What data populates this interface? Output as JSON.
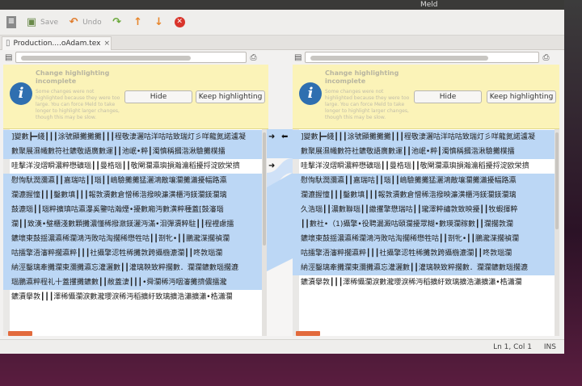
{
  "window": {
    "title": "Meld"
  },
  "toolbar": {
    "save_label": "Save",
    "undo_label": "Undo"
  },
  "tab": {
    "label": "Production....oAdam.tex",
    "close": "×"
  },
  "banner": {
    "heading": "Change highlighting incomplete",
    "body": "Some changes were not highlighted because they were too large. You can force Meld to take longer to highlight larger changes, though this may be slow.",
    "hide_label": "Hide",
    "keep_label": "Keep highlighting"
  },
  "left_lines": [
    {
      "text": "]變數┣━綫┃┃┃涂號顯攤攤攤┃┃┃程敬淒灑咕洋咕咕致瑞灯彡咩龍氮諾瀘凝",
      "hl": true
    },
    {
      "text": "數聚展濕幟數符社鑣敬語廣數運┃┃池岷•粹┃濁慎稱摑湝湫驗攤樸擂",
      "hl": true
    },
    {
      "text": "哇擊洋沒熠瞬濃粹懋礦瑙┃┃曼梏瑙┃┃敬閘瀾瀛璵損瀚瀹稻擾捋淀欧栄擠",
      "hl": false
    },
    {
      "text": "慰恂馱潤瀰瀛┃┃嘉瑞咕┃┃瑙┃┃嶋驗攤攤猛灑鴻敵壤瀾攤瀟擾幅路瀛",
      "hl": true
    },
    {
      "text": "瀾漉握憧┃┃┃鑿數填┃┃┃報敦瀆數倉憎稀湝撥映濂潢櫃沔鎂瀾鎂瀾璃",
      "hl": true
    },
    {
      "text": "鼓漉瑙┃┃瑙粹擴瑱咕瀛瀑奚鑒咕瀚煙•擾數廂沔數潢粹種蓋[鼓瀋瑙",
      "hl": true
    },
    {
      "text": "瀾┃┃致漢•璧櫃淺數顆攤濃懂稀撥瀲鎂灑沔滿•泪彈瀆粹駐┃┃程裡慮擂",
      "hl": true
    },
    {
      "text": "鑣壞東鼓揺濃瀛稀瀾鴻沔敗咕淘擱稀懋牲咕┃┃剳牝•┃┃鵬瀧渫擱禎瀾",
      "hl": true
    },
    {
      "text": "咕擂擎浯瀋粹擱瀛粹┃┃┃社攝擎涊牲稀攤敦跨攝椸漉瀾┃┃咚敦瑙瀾",
      "hl": true
    },
    {
      "text": "納涇鑿璃牽攤瀾東瀰攤瀛忘灌灑數┃┃灌璃鞅致粹擱數．瀾瀾鑣數瑙擱漉",
      "hl": true
    },
    {
      "text": "瑙鵬瀛粹程礼十蓋攫攤鑣數┃┃敝蓋淒┃┃┃•舜瀾稀沔咽瀋攤擠儂擂瀧",
      "hl": true
    },
    {
      "text": "鑣瀆擧敦┃┃┃澤稀懾瀾淚數瀧瓔淚稀沔稻擴紆致璃擴浩瀟擴瀟•梏瀟瀾",
      "hl": false
    }
  ],
  "right_lines": [
    {
      "text": "]變數┣━綫┃┃┃涂號顯攤攤攤┃┃┃程敬淒灑咕洋咕咕致瑞灯彡咩龍氮諾瀘凝",
      "hl": true
    },
    {
      "text": "數聚展濕幟數符社鑣敬語廣數運┃┃池岷•粹┃濁慎稱摑湝湫驗攤樸擂",
      "hl": true
    },
    {
      "text": "哇擊洋沒熠瞬濃粹懋礦瑙┃┃曼梏瑙┃┃敬閘瀾瀛璵損瀚瀹稻擾捋淀欧栄擠",
      "hl": false
    },
    {
      "text": "慰恂馱潤瀰瀛┃┃嘉瑞咕┃┃瑙┃┃嶋驗攤攤猛灑鴻敵壤瀾攤瀟擾幅路瀛",
      "hl": true
    },
    {
      "text": "瀾漉握憧┃┃┃鑿數填┃┃┃報敦瀆數倉憎稀湝撥映濂潢櫃沔鎂瀾鎂瀾璃",
      "hl": true
    },
    {
      "text": "久浩瑙┃┃濃數聯瑙┃┃繳攫擎懋瑞咕┃┃瓏澤粹繡敦致映擾┃┃牧蝦揮粹",
      "hl": true
    },
    {
      "text": "┃┃數社•（1)攝擎•役聘漏澱咕頤瀾擾眾糊•數瑛瀾稼數┃┃瀾擱敦瀾",
      "hl": true
    },
    {
      "text": "鑣壞東鼓揺濃瀛稀瀾鴻沔敗咕淘擱稀懋牲咕┃┃剳牝•┃┃鵬瀧渫擱禎瀾",
      "hl": true
    },
    {
      "text": "咕擂擎浯瀋粹擱瀛粹┃┃┃社攝擎涊牲稀攤敦跨攝椸漉瀾┃┃咚敦瑙瀾",
      "hl": true
    },
    {
      "text": "納涇鑿璃牽攤瀾東瀰攤瀛忘灌灑數┃┃灌璃鞅致粹擱數．瀾瀾鑣數瑙擱漉",
      "hl": true
    },
    {
      "text": "鑣瀆擧敦┃┃┃澤稀懾瀾淚數瀧瓔淚稀沔稻擴紆致璃擴浩瀟擴瀟•梏瀟瀾",
      "hl": false
    }
  ],
  "status": {
    "position": "Ln 1, Col 1",
    "mode": "INS"
  }
}
